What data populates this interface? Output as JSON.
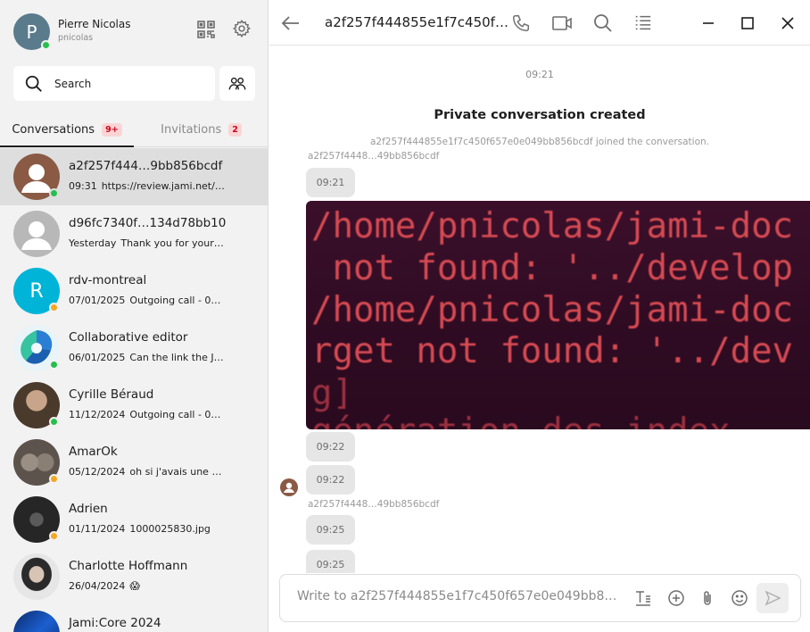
{
  "profile": {
    "initial": "P",
    "name": "Pierre Nicolas",
    "username": "pnicolas",
    "status": "online",
    "qr_icon": "qr-code-icon",
    "settings_icon": "gear-icon"
  },
  "search": {
    "placeholder": "Search",
    "icon": "search-icon",
    "group_icon": "people-icon"
  },
  "tabs": [
    {
      "label": "Conversations",
      "badge": "9+"
    },
    {
      "label": "Invitations",
      "badge": "2"
    }
  ],
  "conversations": [
    {
      "title": "a2f257f444…9bb856bcdf",
      "date": "09:31",
      "preview": "https://review.jami.net/…",
      "avatar": "default-brown",
      "status": "online",
      "selected": true
    },
    {
      "title": "d96fc7340f…134d78bb10",
      "date": "Yesterday",
      "preview": "Thank you for your …",
      "avatar": "default-gray",
      "status": "",
      "selected": false
    },
    {
      "title": "rdv-montreal",
      "date": "07/01/2025",
      "preview": "Outgoing call - 0…",
      "avatar": "R",
      "status": "away",
      "selected": false
    },
    {
      "title": "Collaborative editor",
      "date": "06/01/2025",
      "preview": "Can the link the J…",
      "avatar": "swirl",
      "status": "online",
      "selected": false
    },
    {
      "title": "Cyrille Béraud",
      "date": "11/12/2024",
      "preview": "Outgoing call - 0…",
      "avatar": "photo",
      "status": "online",
      "selected": false
    },
    {
      "title": "AmarOk",
      "date": "05/12/2024",
      "preview": "oh si j'avais une q…",
      "avatar": "cats",
      "status": "away",
      "selected": false
    },
    {
      "title": "Adrien",
      "date": "01/11/2024",
      "preview": "1000025830.jpg",
      "avatar": "photo-dark",
      "status": "away",
      "selected": false
    },
    {
      "title": "Charlotte Hoffmann",
      "date": "26/04/2024",
      "preview": "😱",
      "avatar": "photo-light",
      "status": "",
      "selected": false
    },
    {
      "title": "Jami:Core 2024",
      "date": "",
      "preview": "",
      "avatar": "blue",
      "status": "",
      "selected": false
    }
  ],
  "chat": {
    "title": "a2f257f444855e1f7c450f…",
    "header_icons": [
      "back-arrow-icon",
      "phone-icon",
      "video-camera-icon",
      "search-icon",
      "details-list-icon",
      "minimize-icon",
      "maximize-icon",
      "close-icon"
    ],
    "top_time": "09:21",
    "created": "Private conversation created",
    "joined": "a2f257f444855e1f7c450f657e0e049bb856bcdf joined the conversation.",
    "sender_short": "a2f257f4448…49bb856bcdf",
    "times": [
      "09:21",
      "09:22",
      "09:22",
      "09:25",
      "09:25"
    ],
    "screenshot_lines": [
      "/home/pnicolas/jami-doc",
      " not found: '../develop",
      "/home/pnicolas/jami-doc",
      "rget not found: '../dev",
      "g]",
      "génération des index"
    ]
  },
  "composer": {
    "placeholder": "Write to a2f257f444855e1f7c450f657e0e049bb8…",
    "icons": [
      "text-format-icon",
      "add-circle-icon",
      "paperclip-icon",
      "emoji-icon",
      "send-icon"
    ]
  },
  "colors": {
    "online": "#25c04b",
    "away": "#f5a623",
    "selected_row": "#dedede",
    "badge_bg": "#fbd5d5",
    "badge_text": "#d0021b",
    "rdv_avatar": "#00b4d8"
  }
}
